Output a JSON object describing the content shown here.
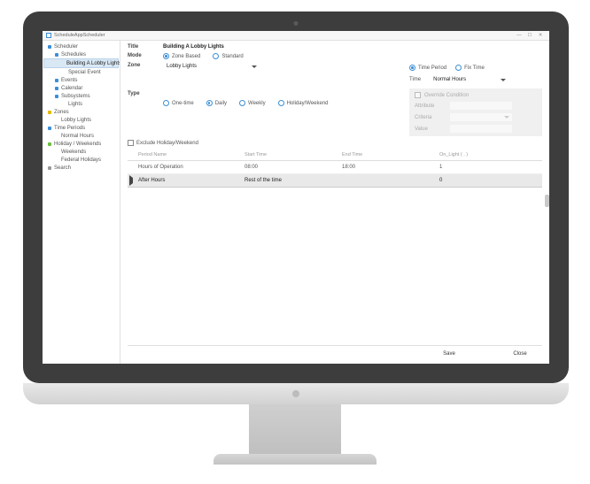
{
  "window": {
    "title": "ScheduleAppScheduler",
    "min": "—",
    "max": "☐",
    "close": "✕"
  },
  "sidebar": {
    "items": [
      {
        "label": "Scheduler",
        "depth": 0,
        "bullet": "blue"
      },
      {
        "label": "Schedules",
        "depth": 1,
        "bullet": "blue"
      },
      {
        "label": "Building A Lobby Lights",
        "depth": 2,
        "bullet": "none",
        "selected": true
      },
      {
        "label": "Special Event",
        "depth": 2,
        "bullet": "none"
      },
      {
        "label": "Events",
        "depth": 1,
        "bullet": "blue"
      },
      {
        "label": "Calendar",
        "depth": 1,
        "bullet": "blue"
      },
      {
        "label": "Subsystems",
        "depth": 1,
        "bullet": "blue"
      },
      {
        "label": "Lights",
        "depth": 2,
        "bullet": "none"
      },
      {
        "label": "Zones",
        "depth": 0,
        "bullet": "yellow"
      },
      {
        "label": "Lobby Lights",
        "depth": 1,
        "bullet": "none"
      },
      {
        "label": "Time Periods",
        "depth": 0,
        "bullet": "blue"
      },
      {
        "label": "Normal Hours",
        "depth": 1,
        "bullet": "none"
      },
      {
        "label": "Holiday / Weekends",
        "depth": 0,
        "bullet": "green"
      },
      {
        "label": "Weekends",
        "depth": 1,
        "bullet": "none"
      },
      {
        "label": "Federal Holidays",
        "depth": 1,
        "bullet": "none"
      },
      {
        "label": "Search",
        "depth": 0,
        "bullet": "grey"
      }
    ]
  },
  "form": {
    "title_label": "Title",
    "title_value": "Building A Lobby Lights",
    "mode_label": "Mode",
    "mode_options": {
      "zone": "Zone Based",
      "standard": "Standard"
    },
    "zone_label": "Zone",
    "zone_value": "Lobby Lights",
    "type_label": "Type",
    "type_options": {
      "onetime": "One-time",
      "daily": "Daily",
      "weekly": "Weekly",
      "hw": "Holiday/Weekend"
    },
    "exclude_label": "Exclude Holiday/Weekend",
    "right": {
      "tp": "Time Period",
      "fix": "Fix Time",
      "time_label": "Time",
      "time_value": "Normal Hours",
      "override": "Override Condition",
      "attribute": "Attribute",
      "criteria": "Criteria",
      "value": "Value"
    }
  },
  "table": {
    "headers": {
      "name": "Period Name",
      "start": "Start Time",
      "end": "End Time",
      "light": "On_Light ( . )"
    },
    "rows": [
      {
        "name": "Hours of Operation",
        "start": "08:00",
        "end": "18:00",
        "light": "1",
        "selected": false
      },
      {
        "name": "After Hours",
        "start": "Rest of the time",
        "end": "",
        "light": "0",
        "selected": true
      }
    ]
  },
  "footer": {
    "save": "Save",
    "close": "Close"
  }
}
